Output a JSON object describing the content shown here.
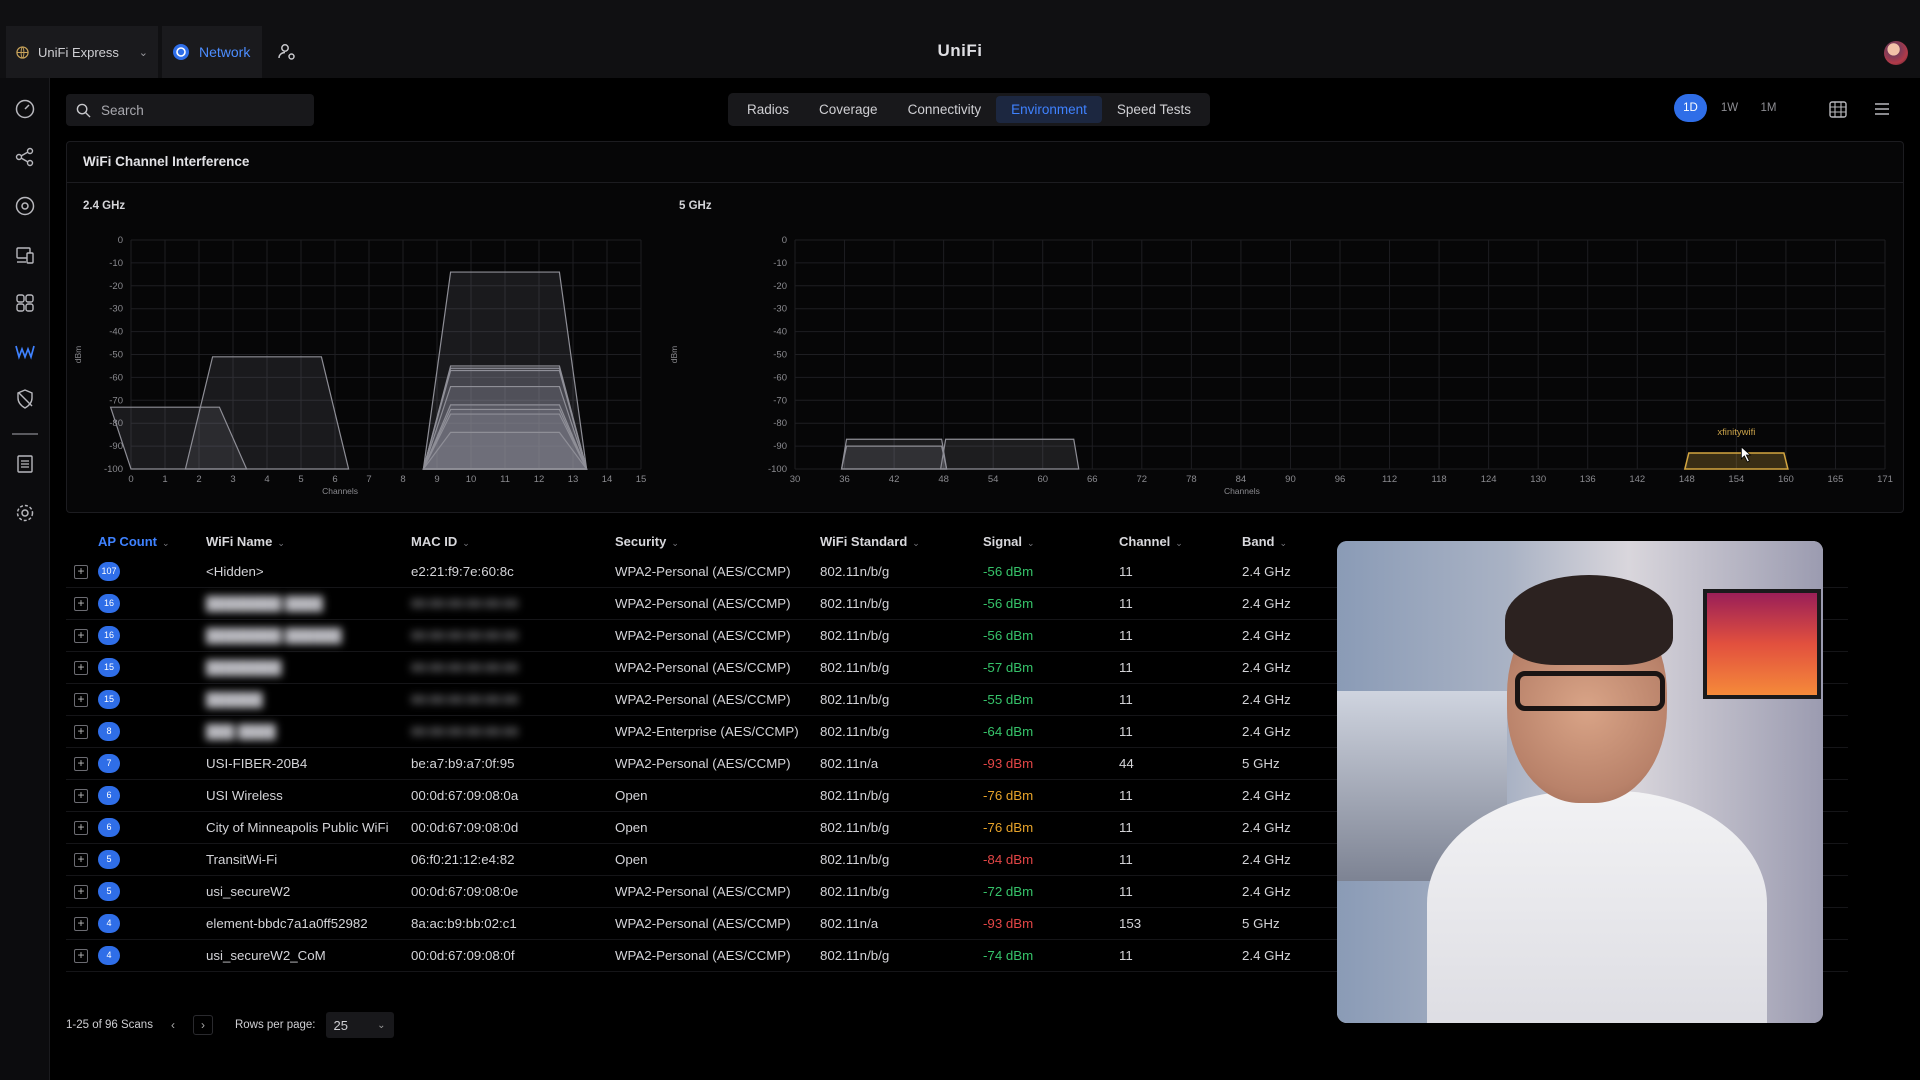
{
  "app": {
    "device": "UniFi Express",
    "network_app": "Network",
    "brand": "UniFi"
  },
  "sidebar": {
    "icons": [
      "dashboard-icon",
      "topology-icon",
      "devices-icon",
      "client-devices-icon",
      "apps-icon",
      "insights-icon",
      "security-icon",
      "logs-icon",
      "settings-icon"
    ],
    "active": "insights-icon"
  },
  "search": {
    "placeholder": "Search"
  },
  "tabs": [
    {
      "label": "Radios",
      "active": false
    },
    {
      "label": "Coverage",
      "active": false
    },
    {
      "label": "Connectivity",
      "active": false
    },
    {
      "label": "Environment",
      "active": true
    },
    {
      "label": "Speed Tests",
      "active": false
    }
  ],
  "time_ranges": [
    {
      "label": "1D",
      "active": true
    },
    {
      "label": "1W",
      "active": false
    },
    {
      "label": "1M",
      "active": false
    }
  ],
  "panel": {
    "title": "WiFi Channel Interference"
  },
  "colors": {
    "accent": "#2f6ee8",
    "signal_good": "#36c36a",
    "signal_mid": "#e7a32a",
    "signal_bad": "#e34646",
    "highlight_network": "#d4a640"
  },
  "chart_data": [
    {
      "type": "area",
      "title": "2.4 GHz",
      "xlabel": "Channels",
      "ylabel": "dBm",
      "x_ticks": [
        "0",
        "1",
        "2",
        "3",
        "4",
        "5",
        "6",
        "7",
        "8",
        "9",
        "10",
        "11",
        "12",
        "13",
        "14",
        "15"
      ],
      "y_ticks": [
        "0",
        "-10",
        "-20",
        "-30",
        "-40",
        "-50",
        "-60",
        "-70",
        "-80",
        "-90",
        "-100"
      ],
      "xlim": [
        0,
        15
      ],
      "ylim": [
        -100,
        0
      ],
      "grid": true,
      "networks": [
        {
          "center": 1,
          "width": 4,
          "signal": -73
        },
        {
          "center": 4,
          "width": 4,
          "signal": -51
        },
        {
          "center": 11,
          "width": 4,
          "signal": -56
        },
        {
          "center": 11,
          "width": 4,
          "signal": -57
        },
        {
          "center": 11,
          "width": 4,
          "signal": -55
        },
        {
          "center": 11,
          "width": 4,
          "signal": -64
        },
        {
          "center": 11,
          "width": 4,
          "signal": -72
        },
        {
          "center": 11,
          "width": 4,
          "signal": -74
        },
        {
          "center": 11,
          "width": 4,
          "signal": -76
        },
        {
          "center": 11,
          "width": 4,
          "signal": -84
        },
        {
          "center": 11,
          "width": 4,
          "signal": -14
        }
      ]
    },
    {
      "type": "area",
      "title": "5 GHz",
      "xlabel": "Channels",
      "ylabel": "dBm",
      "x_ticks": [
        "30",
        "36",
        "42",
        "48",
        "54",
        "60",
        "66",
        "72",
        "78",
        "84",
        "90",
        "96",
        "112",
        "118",
        "124",
        "130",
        "136",
        "142",
        "148",
        "154",
        "160",
        "165",
        "171"
      ],
      "y_ticks": [
        "0",
        "-10",
        "-20",
        "-30",
        "-40",
        "-50",
        "-60",
        "-70",
        "-80",
        "-90",
        "-100"
      ],
      "grid": true,
      "networks": [
        {
          "start": 36,
          "end": 48,
          "signal": -87
        },
        {
          "start": 36,
          "end": 48,
          "signal": -90
        },
        {
          "start": 48,
          "end": 64,
          "signal": -87
        }
      ],
      "highlighted": {
        "label": "xfinitywifi",
        "start": 148,
        "end": 160,
        "signal": -93
      }
    }
  ],
  "table": {
    "columns": [
      "AP Count",
      "WiFi Name",
      "MAC ID",
      "Security",
      "WiFi Standard",
      "Signal",
      "Channel",
      "Band"
    ],
    "sorted_column": "AP Count",
    "rows": [
      {
        "count": "107",
        "name": "<Hidden>",
        "mac": "e2:21:f9:7e:60:8c",
        "security": "WPA2-Personal (AES/CCMP)",
        "standard": "802.11n/b/g",
        "signal": "-56 dBm",
        "level": "good",
        "channel": "11",
        "band": "2.4 GHz",
        "blurred": false
      },
      {
        "count": "16",
        "name": "████████ ████",
        "mac": "00:00:00:00:00:00",
        "security": "WPA2-Personal (AES/CCMP)",
        "standard": "802.11n/b/g",
        "signal": "-56 dBm",
        "level": "good",
        "channel": "11",
        "band": "2.4 GHz",
        "blurred": true
      },
      {
        "count": "16",
        "name": "████████ ██████",
        "mac": "00:00:00:00:00:00",
        "security": "WPA2-Personal (AES/CCMP)",
        "standard": "802.11n/b/g",
        "signal": "-56 dBm",
        "level": "good",
        "channel": "11",
        "band": "2.4 GHz",
        "blurred": true
      },
      {
        "count": "15",
        "name": "████████",
        "mac": "00:00:00:00:00:00",
        "security": "WPA2-Personal (AES/CCMP)",
        "standard": "802.11n/b/g",
        "signal": "-57 dBm",
        "level": "good",
        "channel": "11",
        "band": "2.4 GHz",
        "blurred": true
      },
      {
        "count": "15",
        "name": "██████",
        "mac": "00:00:00:00:00:00",
        "security": "WPA2-Personal (AES/CCMP)",
        "standard": "802.11n/b/g",
        "signal": "-55 dBm",
        "level": "good",
        "channel": "11",
        "band": "2.4 GHz",
        "blurred": true
      },
      {
        "count": "8",
        "name": "███ ████",
        "mac": "00:00:00:00:00:00",
        "security": "WPA2-Enterprise (AES/CCMP)",
        "standard": "802.11n/b/g",
        "signal": "-64 dBm",
        "level": "good",
        "channel": "11",
        "band": "2.4 GHz",
        "blurred": true
      },
      {
        "count": "7",
        "name": "USI-FIBER-20B4",
        "mac": "be:a7:b9:a7:0f:95",
        "security": "WPA2-Personal (AES/CCMP)",
        "standard": "802.11n/a",
        "signal": "-93 dBm",
        "level": "bad",
        "channel": "44",
        "band": "5 GHz",
        "blurred": false
      },
      {
        "count": "6",
        "name": "USI Wireless",
        "mac": "00:0d:67:09:08:0a",
        "security": "Open",
        "standard": "802.11n/b/g",
        "signal": "-76 dBm",
        "level": "mid",
        "channel": "11",
        "band": "2.4 GHz",
        "blurred": false
      },
      {
        "count": "6",
        "name": "City of Minneapolis Public WiFi",
        "mac": "00:0d:67:09:08:0d",
        "security": "Open",
        "standard": "802.11n/b/g",
        "signal": "-76 dBm",
        "level": "mid",
        "channel": "11",
        "band": "2.4 GHz",
        "blurred": false
      },
      {
        "count": "5",
        "name": "TransitWi-Fi",
        "mac": "06:f0:21:12:e4:82",
        "security": "Open",
        "standard": "802.11n/b/g",
        "signal": "-84 dBm",
        "level": "bad",
        "channel": "11",
        "band": "2.4 GHz",
        "blurred": false
      },
      {
        "count": "5",
        "name": "usi_secureW2",
        "mac": "00:0d:67:09:08:0e",
        "security": "WPA2-Personal (AES/CCMP)",
        "standard": "802.11n/b/g",
        "signal": "-72 dBm",
        "level": "good",
        "channel": "11",
        "band": "2.4 GHz",
        "blurred": false
      },
      {
        "count": "4",
        "name": "element-bbdc7a1a0ff52982",
        "mac": "8a:ac:b9:bb:02:c1",
        "security": "WPA2-Personal (AES/CCMP)",
        "standard": "802.11n/a",
        "signal": "-93 dBm",
        "level": "bad",
        "channel": "153",
        "band": "5 GHz",
        "blurred": false
      },
      {
        "count": "4",
        "name": "usi_secureW2_CoM",
        "mac": "00:0d:67:09:08:0f",
        "security": "WPA2-Personal (AES/CCMP)",
        "standard": "802.11n/b/g",
        "signal": "-74 dBm",
        "level": "good",
        "channel": "11",
        "band": "2.4 GHz",
        "blurred": false
      }
    ]
  },
  "footer": {
    "range_text": "1-25 of 96 Scans",
    "rows_label": "Rows per page:",
    "rows_value": "25"
  }
}
